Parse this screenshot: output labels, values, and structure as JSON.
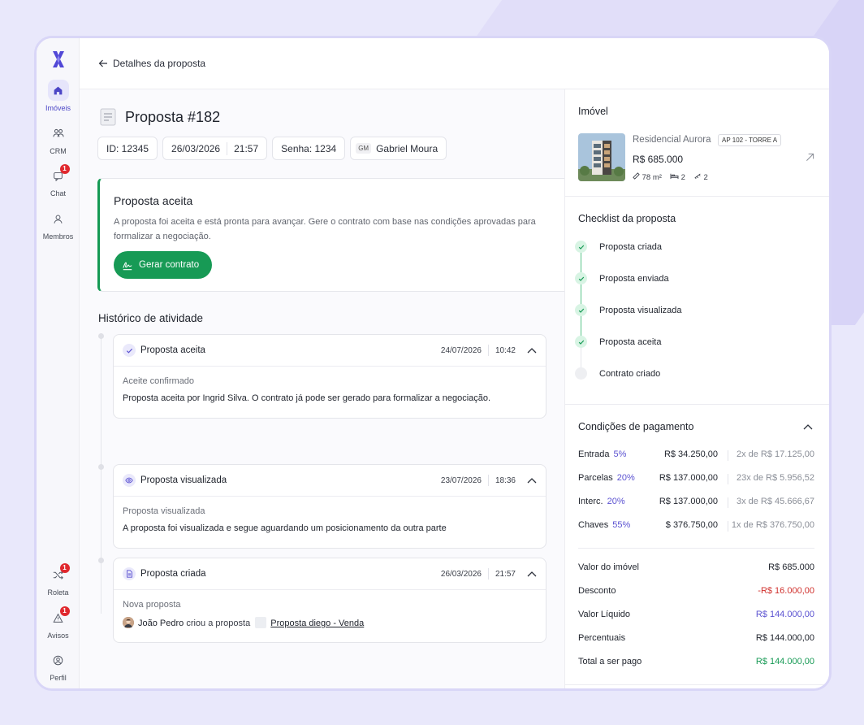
{
  "sidebar": {
    "items": [
      {
        "label": "Imóveis",
        "icon": "home-icon",
        "active": true
      },
      {
        "label": "CRM",
        "icon": "users-group-icon"
      },
      {
        "label": "Chat",
        "icon": "chat-icon",
        "badge": "1"
      },
      {
        "label": "Membros",
        "icon": "user-icon"
      }
    ],
    "bottom_items": [
      {
        "label": "Roleta",
        "icon": "shuffle-icon",
        "badge": "1"
      },
      {
        "label": "Avisos",
        "icon": "alert-icon",
        "badge": "1"
      },
      {
        "label": "Perfil",
        "icon": "profile-icon"
      }
    ]
  },
  "header": {
    "back_label": "Detalhes da proposta"
  },
  "proposal": {
    "title": "Proposta #182",
    "id": "ID: 12345",
    "date": "26/03/2026",
    "time": "21:57",
    "password": "Senha: 1234",
    "agent_initials": "GM",
    "agent_name": "Gabriel Moura"
  },
  "accepted_card": {
    "title": "Proposta aceita",
    "text": "A proposta foi aceita e está pronta para avançar. Gere o contrato com base nas condições aprovadas para formalizar a negociação.",
    "button": "Gerar contrato"
  },
  "history": {
    "title": "Histórico de atividade",
    "items": [
      {
        "name": "Proposta aceita",
        "date": "24/07/2026",
        "time": "10:42",
        "sub": "Aceite confirmado",
        "text": "Proposta aceita por Ingrid Silva. O contrato já pode ser gerado para formalizar a negociação."
      },
      {
        "name": "Proposta visualizada",
        "date": "23/07/2026",
        "time": "18:36",
        "sub": "Proposta visualizada",
        "text": "A proposta foi visualizada e segue aguardando um posicionamento da outra parte"
      },
      {
        "name": "Proposta criada",
        "date": "26/03/2026",
        "time": "21:57",
        "sub": "Nova proposta",
        "author": "João Pedro",
        "action": "criou a proposta",
        "link": "Proposta diego - Venda"
      }
    ]
  },
  "property": {
    "section_title": "Imóvel",
    "name": "Residencial Aurora",
    "unit": "AP 102 - TORRE A",
    "price": "R$ 685.000",
    "area": "78 m²",
    "beds": "2",
    "baths": "2"
  },
  "checklist": {
    "title": "Checklist da proposta",
    "items": [
      {
        "label": "Proposta criada",
        "done": true
      },
      {
        "label": "Proposta enviada",
        "done": true
      },
      {
        "label": "Proposta visualizada",
        "done": true
      },
      {
        "label": "Proposta aceita",
        "done": true
      },
      {
        "label": "Contrato criado",
        "done": false
      }
    ]
  },
  "payment": {
    "title": "Condições de pagamento",
    "rows": [
      {
        "label": "Entrada",
        "pct": "5%",
        "amount": "R$ 34.250,00",
        "installments": "2x de R$ 17.125,00"
      },
      {
        "label": "Parcelas",
        "pct": "20%",
        "amount": "R$ 137.000,00",
        "installments": "23x de R$ 5.956,52"
      },
      {
        "label": "Interc.",
        "pct": "20%",
        "amount": "R$ 137.000,00",
        "installments": "3x de R$ 45.666,67"
      },
      {
        "label": "Chaves",
        "pct": "55%",
        "amount": "$ 376.750,00",
        "installments": "1x de R$ 376.750,00"
      }
    ],
    "summary": [
      {
        "label": "Valor do imóvel",
        "value": "R$ 685.000"
      },
      {
        "label": "Desconto",
        "value": "-R$ 16.000,00"
      },
      {
        "label": "Valor Líquido",
        "value": "R$ 144.000,00"
      },
      {
        "label": "Percentuais",
        "value": "R$ 144.000,00"
      },
      {
        "label": "Total a ser pago",
        "value": "R$ 144.000,00"
      }
    ]
  },
  "colors": {
    "brand": "#4b45c6",
    "success": "#179a55",
    "danger": "#d0312d",
    "accent": "#5b52d1"
  }
}
